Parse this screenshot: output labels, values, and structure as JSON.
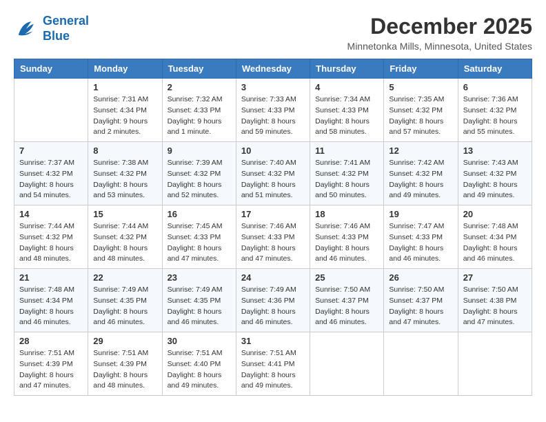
{
  "logo": {
    "line1": "General",
    "line2": "Blue"
  },
  "title": "December 2025",
  "location": "Minnetonka Mills, Minnesota, United States",
  "headers": [
    "Sunday",
    "Monday",
    "Tuesday",
    "Wednesday",
    "Thursday",
    "Friday",
    "Saturday"
  ],
  "weeks": [
    [
      {
        "day": "",
        "sunrise": "",
        "sunset": "",
        "daylight": ""
      },
      {
        "day": "1",
        "sunrise": "Sunrise: 7:31 AM",
        "sunset": "Sunset: 4:34 PM",
        "daylight": "Daylight: 9 hours and 2 minutes."
      },
      {
        "day": "2",
        "sunrise": "Sunrise: 7:32 AM",
        "sunset": "Sunset: 4:33 PM",
        "daylight": "Daylight: 9 hours and 1 minute."
      },
      {
        "day": "3",
        "sunrise": "Sunrise: 7:33 AM",
        "sunset": "Sunset: 4:33 PM",
        "daylight": "Daylight: 8 hours and 59 minutes."
      },
      {
        "day": "4",
        "sunrise": "Sunrise: 7:34 AM",
        "sunset": "Sunset: 4:33 PM",
        "daylight": "Daylight: 8 hours and 58 minutes."
      },
      {
        "day": "5",
        "sunrise": "Sunrise: 7:35 AM",
        "sunset": "Sunset: 4:32 PM",
        "daylight": "Daylight: 8 hours and 57 minutes."
      },
      {
        "day": "6",
        "sunrise": "Sunrise: 7:36 AM",
        "sunset": "Sunset: 4:32 PM",
        "daylight": "Daylight: 8 hours and 55 minutes."
      }
    ],
    [
      {
        "day": "7",
        "sunrise": "Sunrise: 7:37 AM",
        "sunset": "Sunset: 4:32 PM",
        "daylight": "Daylight: 8 hours and 54 minutes."
      },
      {
        "day": "8",
        "sunrise": "Sunrise: 7:38 AM",
        "sunset": "Sunset: 4:32 PM",
        "daylight": "Daylight: 8 hours and 53 minutes."
      },
      {
        "day": "9",
        "sunrise": "Sunrise: 7:39 AM",
        "sunset": "Sunset: 4:32 PM",
        "daylight": "Daylight: 8 hours and 52 minutes."
      },
      {
        "day": "10",
        "sunrise": "Sunrise: 7:40 AM",
        "sunset": "Sunset: 4:32 PM",
        "daylight": "Daylight: 8 hours and 51 minutes."
      },
      {
        "day": "11",
        "sunrise": "Sunrise: 7:41 AM",
        "sunset": "Sunset: 4:32 PM",
        "daylight": "Daylight: 8 hours and 50 minutes."
      },
      {
        "day": "12",
        "sunrise": "Sunrise: 7:42 AM",
        "sunset": "Sunset: 4:32 PM",
        "daylight": "Daylight: 8 hours and 49 minutes."
      },
      {
        "day": "13",
        "sunrise": "Sunrise: 7:43 AM",
        "sunset": "Sunset: 4:32 PM",
        "daylight": "Daylight: 8 hours and 49 minutes."
      }
    ],
    [
      {
        "day": "14",
        "sunrise": "Sunrise: 7:44 AM",
        "sunset": "Sunset: 4:32 PM",
        "daylight": "Daylight: 8 hours and 48 minutes."
      },
      {
        "day": "15",
        "sunrise": "Sunrise: 7:44 AM",
        "sunset": "Sunset: 4:32 PM",
        "daylight": "Daylight: 8 hours and 48 minutes."
      },
      {
        "day": "16",
        "sunrise": "Sunrise: 7:45 AM",
        "sunset": "Sunset: 4:33 PM",
        "daylight": "Daylight: 8 hours and 47 minutes."
      },
      {
        "day": "17",
        "sunrise": "Sunrise: 7:46 AM",
        "sunset": "Sunset: 4:33 PM",
        "daylight": "Daylight: 8 hours and 47 minutes."
      },
      {
        "day": "18",
        "sunrise": "Sunrise: 7:46 AM",
        "sunset": "Sunset: 4:33 PM",
        "daylight": "Daylight: 8 hours and 46 minutes."
      },
      {
        "day": "19",
        "sunrise": "Sunrise: 7:47 AM",
        "sunset": "Sunset: 4:33 PM",
        "daylight": "Daylight: 8 hours and 46 minutes."
      },
      {
        "day": "20",
        "sunrise": "Sunrise: 7:48 AM",
        "sunset": "Sunset: 4:34 PM",
        "daylight": "Daylight: 8 hours and 46 minutes."
      }
    ],
    [
      {
        "day": "21",
        "sunrise": "Sunrise: 7:48 AM",
        "sunset": "Sunset: 4:34 PM",
        "daylight": "Daylight: 8 hours and 46 minutes."
      },
      {
        "day": "22",
        "sunrise": "Sunrise: 7:49 AM",
        "sunset": "Sunset: 4:35 PM",
        "daylight": "Daylight: 8 hours and 46 minutes."
      },
      {
        "day": "23",
        "sunrise": "Sunrise: 7:49 AM",
        "sunset": "Sunset: 4:35 PM",
        "daylight": "Daylight: 8 hours and 46 minutes."
      },
      {
        "day": "24",
        "sunrise": "Sunrise: 7:49 AM",
        "sunset": "Sunset: 4:36 PM",
        "daylight": "Daylight: 8 hours and 46 minutes."
      },
      {
        "day": "25",
        "sunrise": "Sunrise: 7:50 AM",
        "sunset": "Sunset: 4:37 PM",
        "daylight": "Daylight: 8 hours and 46 minutes."
      },
      {
        "day": "26",
        "sunrise": "Sunrise: 7:50 AM",
        "sunset": "Sunset: 4:37 PM",
        "daylight": "Daylight: 8 hours and 47 minutes."
      },
      {
        "day": "27",
        "sunrise": "Sunrise: 7:50 AM",
        "sunset": "Sunset: 4:38 PM",
        "daylight": "Daylight: 8 hours and 47 minutes."
      }
    ],
    [
      {
        "day": "28",
        "sunrise": "Sunrise: 7:51 AM",
        "sunset": "Sunset: 4:39 PM",
        "daylight": "Daylight: 8 hours and 47 minutes."
      },
      {
        "day": "29",
        "sunrise": "Sunrise: 7:51 AM",
        "sunset": "Sunset: 4:39 PM",
        "daylight": "Daylight: 8 hours and 48 minutes."
      },
      {
        "day": "30",
        "sunrise": "Sunrise: 7:51 AM",
        "sunset": "Sunset: 4:40 PM",
        "daylight": "Daylight: 8 hours and 49 minutes."
      },
      {
        "day": "31",
        "sunrise": "Sunrise: 7:51 AM",
        "sunset": "Sunset: 4:41 PM",
        "daylight": "Daylight: 8 hours and 49 minutes."
      },
      {
        "day": "",
        "sunrise": "",
        "sunset": "",
        "daylight": ""
      },
      {
        "day": "",
        "sunrise": "",
        "sunset": "",
        "daylight": ""
      },
      {
        "day": "",
        "sunrise": "",
        "sunset": "",
        "daylight": ""
      }
    ]
  ]
}
